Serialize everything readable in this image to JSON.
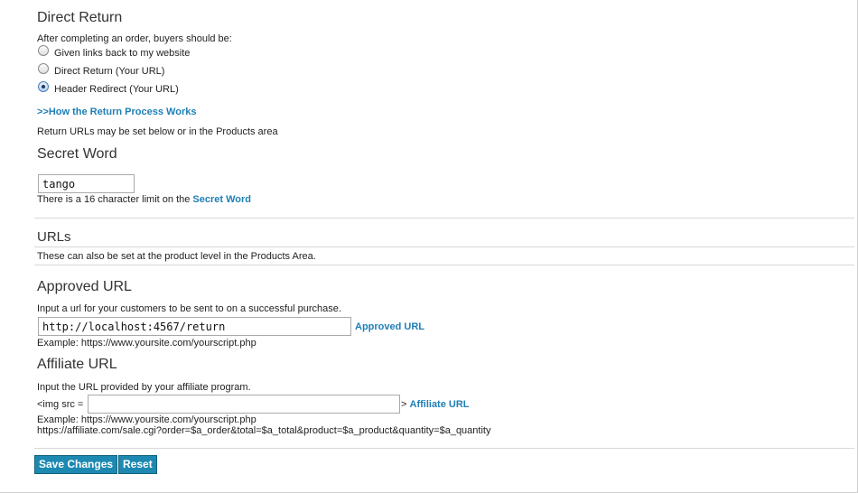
{
  "direct_return": {
    "title": "Direct Return",
    "prompt": "After completing an order, buyers should be:",
    "options": [
      {
        "label": "Given links back to my website",
        "selected": false
      },
      {
        "label": "Direct Return (Your URL)",
        "selected": false
      },
      {
        "label": "Header Redirect (Your URL)",
        "selected": true
      }
    ],
    "help_link": ">>How the Return Process Works",
    "note": "Return URLs may be set below or in the Products area"
  },
  "secret_word": {
    "title": "Secret Word",
    "value": "tango",
    "limit_text": "There is a 16 character limit on the ",
    "limit_link": "Secret Word"
  },
  "urls": {
    "title": "URLs",
    "note": "These can also be set at the product level in the Products Area."
  },
  "approved_url": {
    "title": "Approved URL",
    "prompt": "Input a url for your customers to be sent to on a successful purchase.",
    "value": "http://localhost:4567/return",
    "link": "Approved URL",
    "example": "Example: https://www.yoursite.com/yourscript.php"
  },
  "affiliate_url": {
    "title": "Affiliate URL",
    "prompt": "Input the URL provided by your affiliate program.",
    "prefix": "<img src =",
    "value": "",
    "suffix": ">",
    "link": "Affiliate URL",
    "example": "Example: https://www.yoursite.com/yourscript.php",
    "example2": "https://affiliate.com/sale.cgi?order=$a_order&total=$a_total&product=$a_product&quantity=$a_quantity"
  },
  "actions": {
    "save_label": "Save Changes",
    "reset_label": "Reset"
  }
}
